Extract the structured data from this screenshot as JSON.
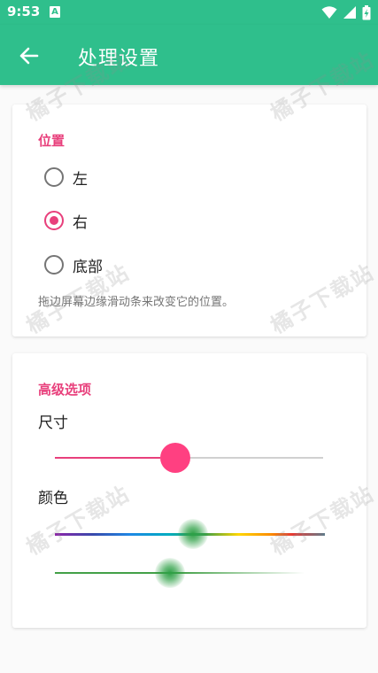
{
  "status_bar": {
    "time": "9:53",
    "notif_icon_letter": "A"
  },
  "app_bar": {
    "title": "处理设置"
  },
  "position_section": {
    "title": "位置",
    "options": [
      {
        "label": "左",
        "checked": false
      },
      {
        "label": "右",
        "checked": true
      },
      {
        "label": "底部",
        "checked": false
      }
    ],
    "description": "拖边屏幕边缘滑动条来改变它的位置。"
  },
  "advanced_section": {
    "title": "高级选项",
    "size_label": "尺寸",
    "size_value": 0.45,
    "color_label": "颜色",
    "hue_value": 0.51,
    "alpha_value": 0.46
  },
  "watermark": "橘子下载站",
  "colors": {
    "primary": "#2fbf8c",
    "accent": "#e8407c",
    "thumb": "#ff4081"
  }
}
